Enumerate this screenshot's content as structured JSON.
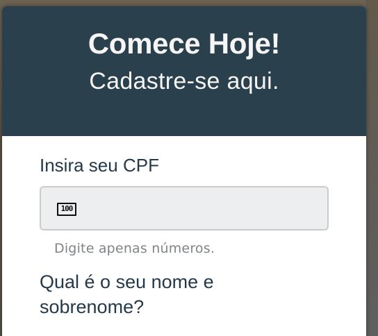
{
  "header": {
    "title": "Comece Hoje!",
    "subtitle": "Cadastre-se aqui."
  },
  "form": {
    "cpf_label": "Insira seu CPF",
    "cpf_icon": "numeric-keypad-icon",
    "cpf_icon_glyph": "100",
    "cpf_value": "",
    "cpf_hint": "Digite apenas números.",
    "name_label": "Qual é o seu nome e sobrenome?"
  },
  "colors": {
    "header_bg": "#2a404c",
    "label_text": "#24394a",
    "input_bg": "#eceeef",
    "hint_text": "#7f8486"
  }
}
